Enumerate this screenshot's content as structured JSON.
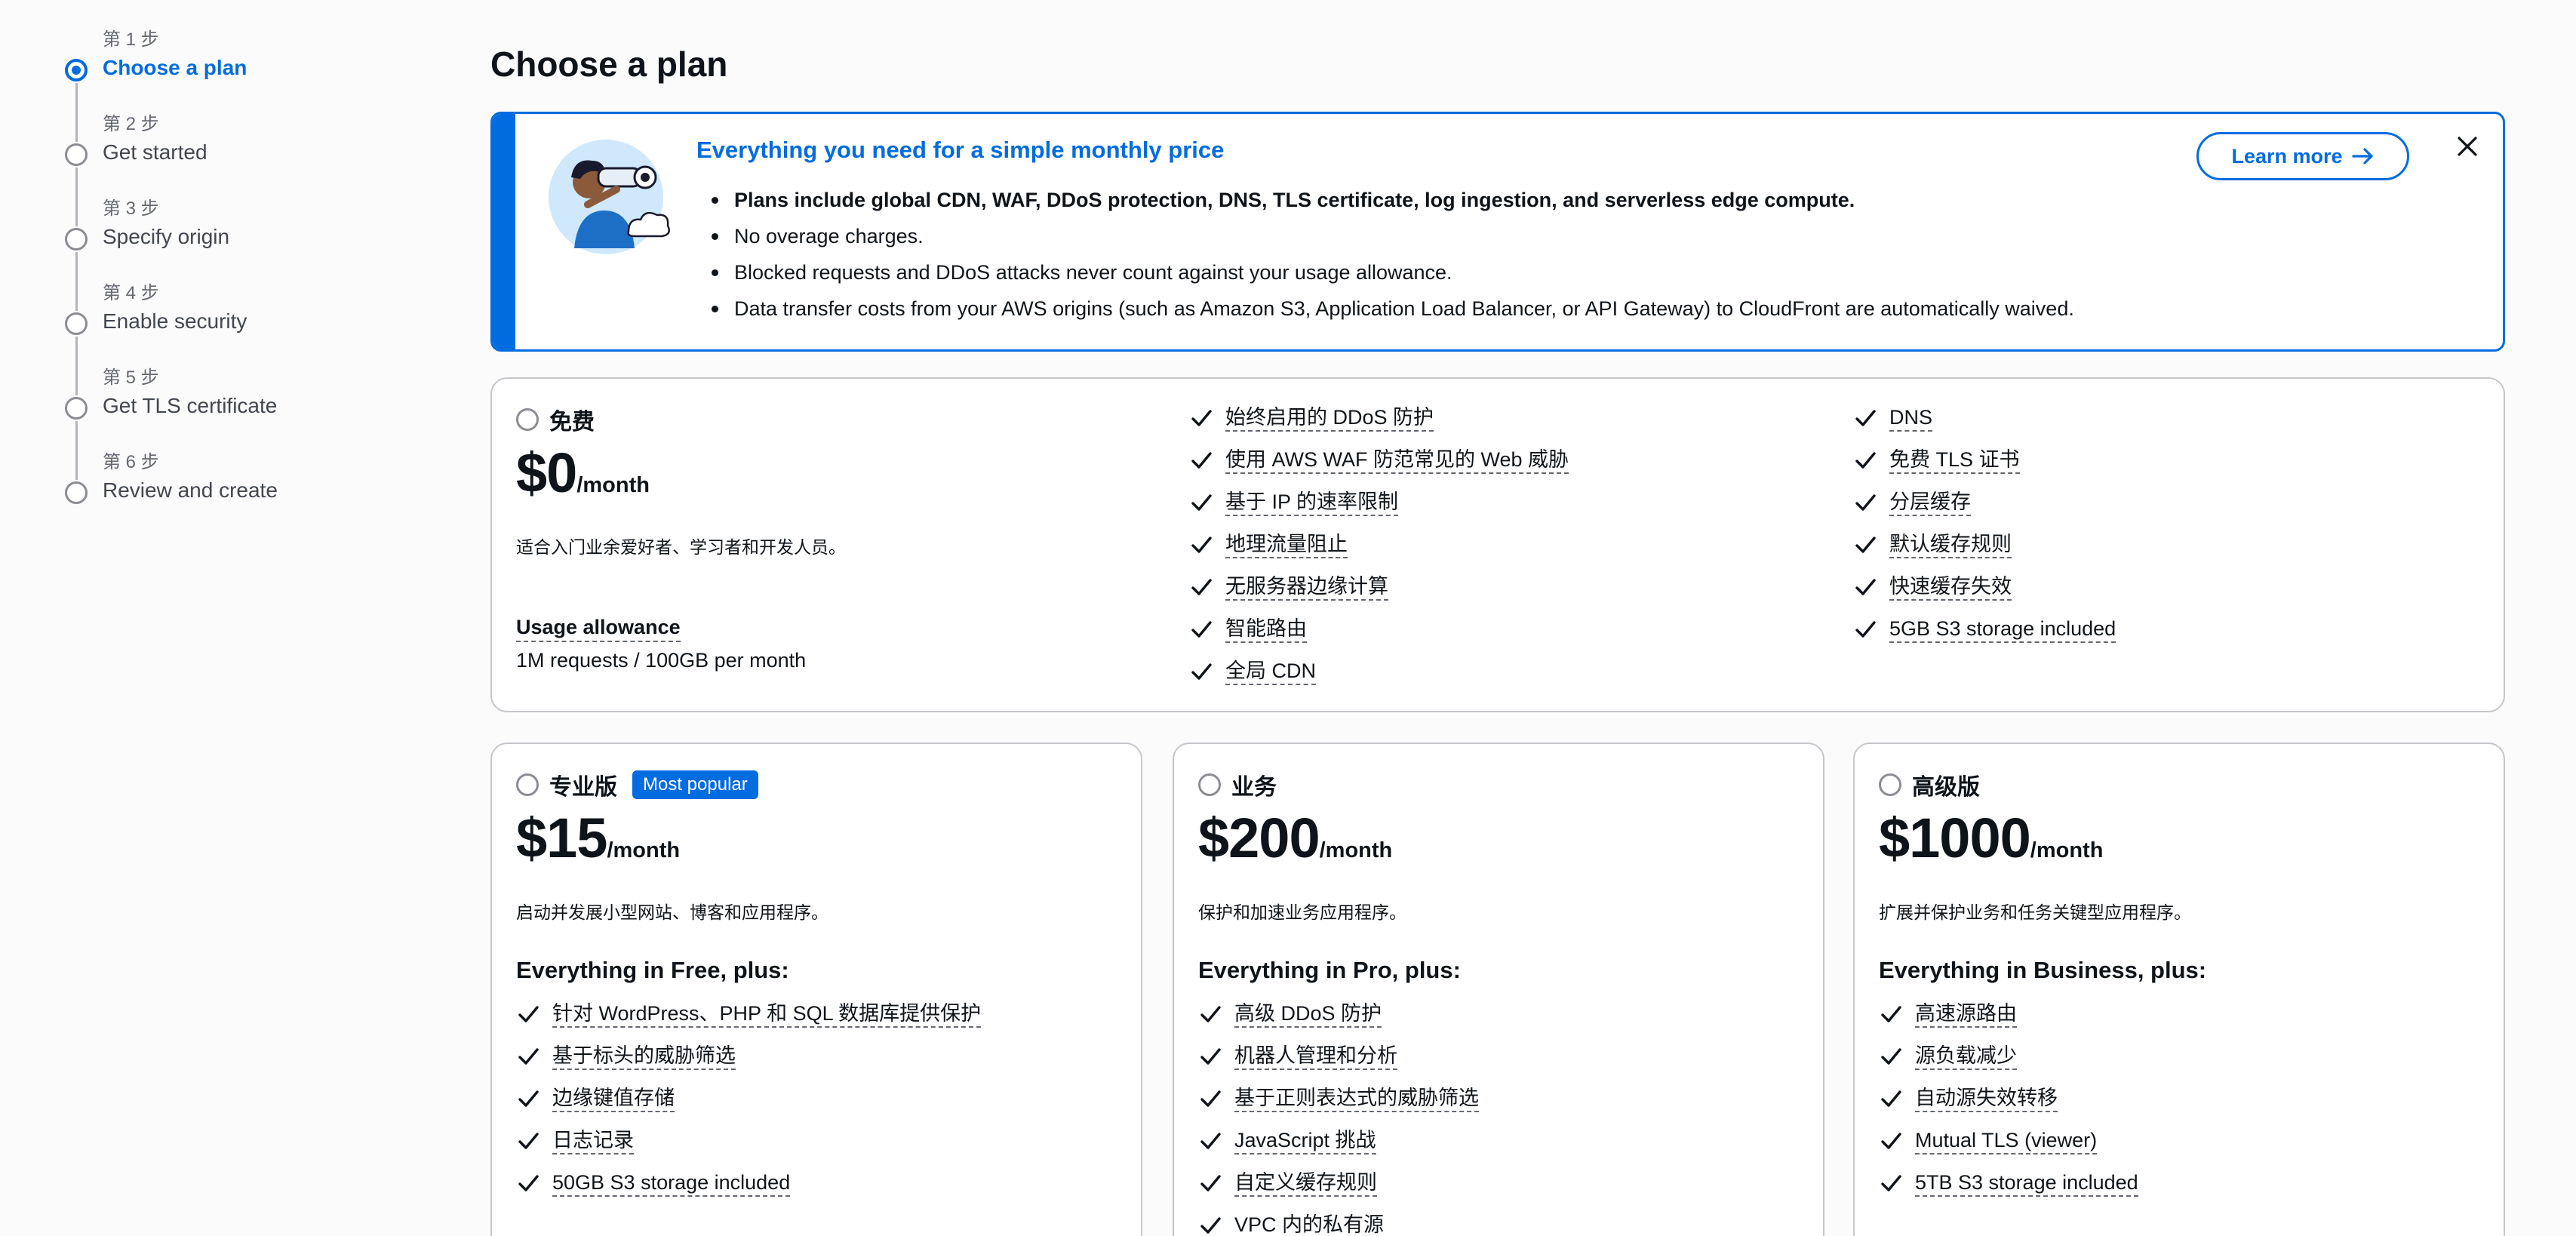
{
  "sidebar": {
    "steps": [
      {
        "num": "第 1 步",
        "title": "Choose a plan",
        "active": true
      },
      {
        "num": "第 2 步",
        "title": "Get started"
      },
      {
        "num": "第 3 步",
        "title": "Specify origin"
      },
      {
        "num": "第 4 步",
        "title": "Enable security"
      },
      {
        "num": "第 5 步",
        "title": "Get TLS certificate"
      },
      {
        "num": "第 6 步",
        "title": "Review and create"
      }
    ]
  },
  "page": {
    "title": "Choose a plan"
  },
  "banner": {
    "title": "Everything you need for a simple monthly price",
    "bullets": [
      "Plans include global CDN, WAF, DDoS protection, DNS, TLS certificate, log ingestion, and serverless edge compute.",
      "No overage charges.",
      "Blocked requests and DDoS attacks never count against your usage allowance.",
      "Data transfer costs from your AWS origins (such as Amazon S3, Application Load Balancer, or API Gateway) to CloudFront are automatically waived."
    ],
    "learn_more": "Learn more",
    "accent_color": "#006ce0"
  },
  "plans": {
    "free": {
      "name": "免费",
      "price": "$0",
      "per": "/month",
      "desc": "适合入门业余爱好者、学习者和开发人员。",
      "usage_title": "Usage allowance",
      "usage_value": "1M requests / 100GB per month",
      "features_col1": [
        "始终启用的 DDoS 防护",
        "使用 AWS WAF 防范常见的 Web 威胁",
        "基于 IP 的速率限制",
        "地理流量阻止",
        "无服务器边缘计算",
        "智能路由",
        "全局 CDN"
      ],
      "features_col2": [
        "DNS",
        "免费 TLS 证书",
        "分层缓存",
        "默认缓存规则",
        "快速缓存失效",
        "5GB S3 storage included"
      ]
    },
    "pro": {
      "name": "专业版",
      "badge": "Most popular",
      "price": "$15",
      "per": "/month",
      "desc": "启动并发展小型网站、博客和应用程序。",
      "plus": "Everything in Free, plus:",
      "features": [
        "针对 WordPress、PHP 和 SQL 数据库提供保护",
        "基于标头的威胁筛选",
        "边缘键值存储",
        "日志记录",
        "50GB S3 storage included"
      ]
    },
    "business": {
      "name": "业务",
      "price": "$200",
      "per": "/month",
      "desc": "保护和加速业务应用程序。",
      "plus": "Everything in Pro, plus:",
      "features": [
        "高级 DDoS 防护",
        "机器人管理和分析",
        "基于正则表达式的威胁筛选",
        "JavaScript 挑战",
        "自定义缓存规则",
        "VPC 内的私有源"
      ]
    },
    "premium": {
      "name": "高级版",
      "price": "$1000",
      "per": "/month",
      "desc": "扩展并保护业务和任务关键型应用程序。",
      "plus": "Everything in Business, plus:",
      "features": [
        "高速源路由",
        "源负载减少",
        "自动源失效转移",
        "Mutual TLS (viewer)",
        "5TB S3 storage included"
      ]
    }
  }
}
